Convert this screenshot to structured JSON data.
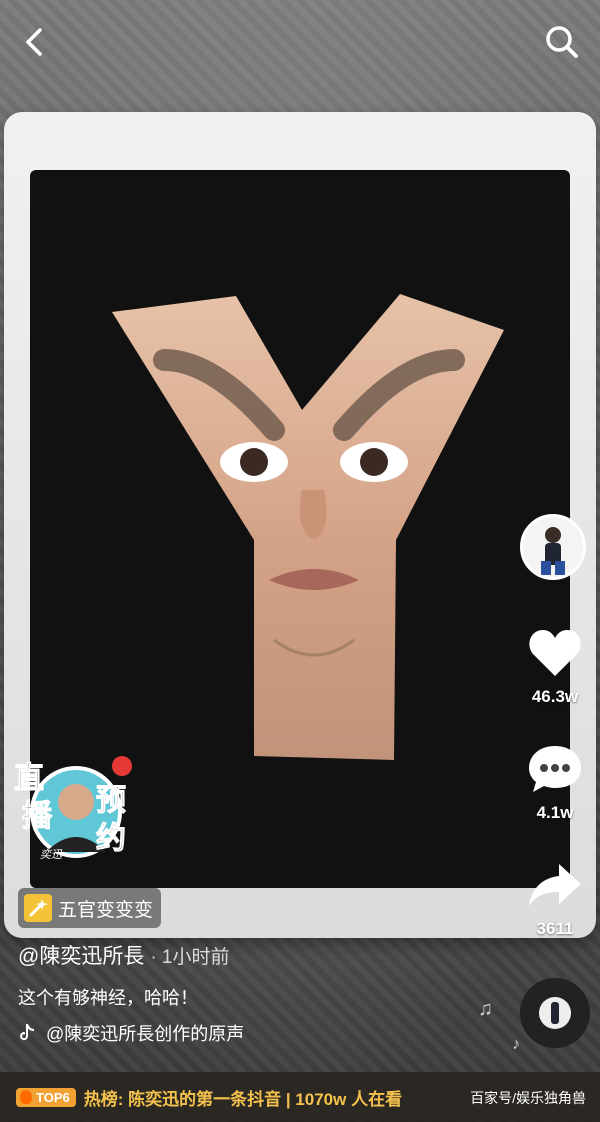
{
  "header": {
    "back_icon": "back-arrow-icon",
    "search_icon": "search-icon"
  },
  "video": {
    "effect_label": "五官变变变"
  },
  "badge": {
    "chars_left": [
      "直",
      "播"
    ],
    "chars_right": [
      "预",
      "约"
    ],
    "signature": "奕迅"
  },
  "actions": {
    "like_count": "46.3w",
    "comment_count": "4.1w",
    "share_count": "3611"
  },
  "post": {
    "author": "@陳奕迅所長",
    "time": "· 1小时前",
    "caption": "这个有够神经，哈哈！",
    "sound": "@陳奕迅所長创作的原声"
  },
  "hotbar": {
    "tag": "TOP6",
    "text": "热榜: 陈奕迅的第一条抖音 | 1070w 人在看"
  },
  "watermark": "百家号/娱乐独角兽",
  "colors": {
    "accent": "#f4c24c",
    "tag": "#f2a233",
    "badge_red": "#e53935"
  }
}
